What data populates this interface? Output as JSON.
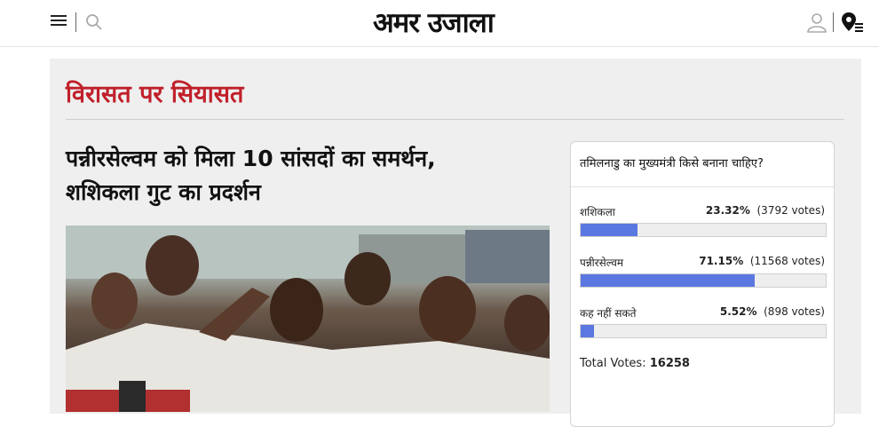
{
  "header": {
    "logo": "अमर उजाला",
    "icons": [
      "menu-icon",
      "search-icon",
      "user-icon",
      "location-menu-icon"
    ]
  },
  "section": {
    "title": "विरासत पर सियासत"
  },
  "article": {
    "headline_line1": "पन्नीरसेल्वम को मिला 10 सांसदों का समर्थन,",
    "headline_line2": "शशिकला गुट का प्रदर्शन"
  },
  "poll": {
    "question": "तमिलनाडु का मुख्यमंत्री किसे बनाना चाहिए?",
    "options": [
      {
        "label": "शशिकला",
        "percent": "23.32%",
        "votes": "(3792 votes)",
        "share": 0.2332
      },
      {
        "label": "पन्नीरसेल्वम",
        "percent": "71.15%",
        "votes": "(11568 votes)",
        "share": 0.7115
      },
      {
        "label": "कह नहीं सकते",
        "percent": "5.52%",
        "votes": "(898 votes)",
        "share": 0.0552
      }
    ],
    "total_label": "Total Votes:",
    "total_value": "16258"
  },
  "colors": {
    "accent": "#c0202a",
    "bar": "#5b78e0",
    "panel": "#efefef"
  }
}
